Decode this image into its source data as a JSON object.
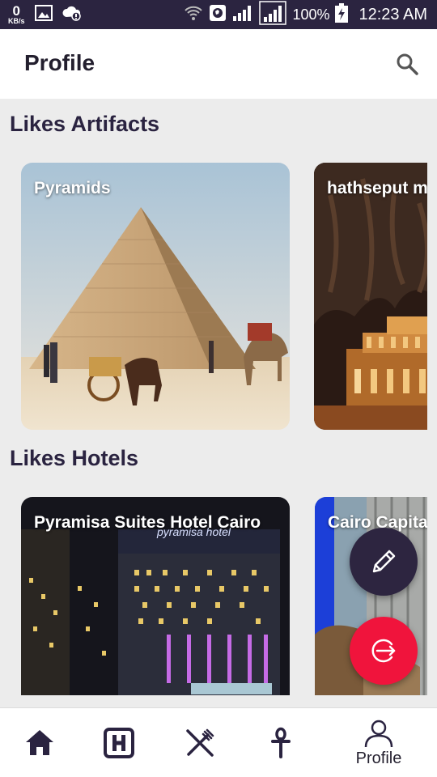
{
  "status_bar": {
    "net_speed": "0",
    "net_unit": "KB/s",
    "battery": "100%",
    "time": "12:23 AM"
  },
  "header": {
    "title": "Profile",
    "search_icon": "search-icon"
  },
  "sections": {
    "artifacts": {
      "title": "Likes Artifacts",
      "cards": [
        {
          "label": "Pyramids"
        },
        {
          "label": "hathseput m"
        }
      ]
    },
    "hotels": {
      "title": "Likes Hotels",
      "cards": [
        {
          "label": "Pyramisa Suites Hotel Cairo",
          "sign_text": "pyramisa hotel"
        },
        {
          "label": "Cairo Capita"
        }
      ]
    }
  },
  "fabs": {
    "edit_icon": "pencil-icon",
    "logout_icon": "logout-icon",
    "logout_color": "#f0143c",
    "edit_color": "#2d2540"
  },
  "bottom_nav": {
    "items": [
      {
        "icon": "home-icon"
      },
      {
        "icon": "hotel-icon"
      },
      {
        "icon": "restaurant-icon"
      },
      {
        "icon": "ankh-icon"
      },
      {
        "icon": "person-icon",
        "label": "Profile"
      }
    ]
  },
  "colors": {
    "status_bar": "#2b2440",
    "title_text": "#231f2e",
    "section_text": "#2a2340",
    "background": "#ececec"
  }
}
